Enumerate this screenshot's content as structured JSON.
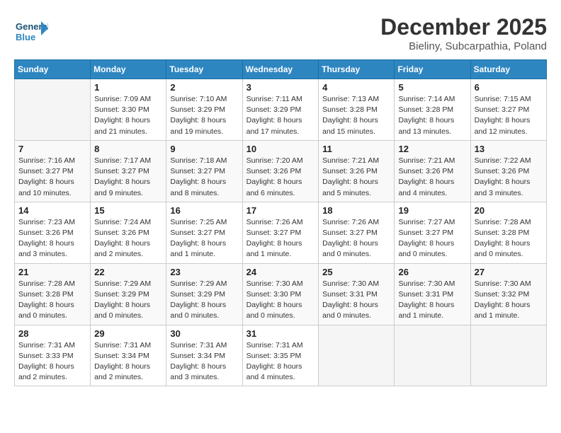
{
  "header": {
    "logo_general": "General",
    "logo_blue": "Blue",
    "month": "December 2025",
    "location": "Bieliny, Subcarpathia, Poland"
  },
  "weekdays": [
    "Sunday",
    "Monday",
    "Tuesday",
    "Wednesday",
    "Thursday",
    "Friday",
    "Saturday"
  ],
  "weeks": [
    [
      {
        "day": "",
        "info": ""
      },
      {
        "day": "1",
        "info": "Sunrise: 7:09 AM\nSunset: 3:30 PM\nDaylight: 8 hours\nand 21 minutes."
      },
      {
        "day": "2",
        "info": "Sunrise: 7:10 AM\nSunset: 3:29 PM\nDaylight: 8 hours\nand 19 minutes."
      },
      {
        "day": "3",
        "info": "Sunrise: 7:11 AM\nSunset: 3:29 PM\nDaylight: 8 hours\nand 17 minutes."
      },
      {
        "day": "4",
        "info": "Sunrise: 7:13 AM\nSunset: 3:28 PM\nDaylight: 8 hours\nand 15 minutes."
      },
      {
        "day": "5",
        "info": "Sunrise: 7:14 AM\nSunset: 3:28 PM\nDaylight: 8 hours\nand 13 minutes."
      },
      {
        "day": "6",
        "info": "Sunrise: 7:15 AM\nSunset: 3:27 PM\nDaylight: 8 hours\nand 12 minutes."
      }
    ],
    [
      {
        "day": "7",
        "info": "Sunrise: 7:16 AM\nSunset: 3:27 PM\nDaylight: 8 hours\nand 10 minutes."
      },
      {
        "day": "8",
        "info": "Sunrise: 7:17 AM\nSunset: 3:27 PM\nDaylight: 8 hours\nand 9 minutes."
      },
      {
        "day": "9",
        "info": "Sunrise: 7:18 AM\nSunset: 3:27 PM\nDaylight: 8 hours\nand 8 minutes."
      },
      {
        "day": "10",
        "info": "Sunrise: 7:20 AM\nSunset: 3:26 PM\nDaylight: 8 hours\nand 6 minutes."
      },
      {
        "day": "11",
        "info": "Sunrise: 7:21 AM\nSunset: 3:26 PM\nDaylight: 8 hours\nand 5 minutes."
      },
      {
        "day": "12",
        "info": "Sunrise: 7:21 AM\nSunset: 3:26 PM\nDaylight: 8 hours\nand 4 minutes."
      },
      {
        "day": "13",
        "info": "Sunrise: 7:22 AM\nSunset: 3:26 PM\nDaylight: 8 hours\nand 3 minutes."
      }
    ],
    [
      {
        "day": "14",
        "info": "Sunrise: 7:23 AM\nSunset: 3:26 PM\nDaylight: 8 hours\nand 3 minutes."
      },
      {
        "day": "15",
        "info": "Sunrise: 7:24 AM\nSunset: 3:26 PM\nDaylight: 8 hours\nand 2 minutes."
      },
      {
        "day": "16",
        "info": "Sunrise: 7:25 AM\nSunset: 3:27 PM\nDaylight: 8 hours\nand 1 minute."
      },
      {
        "day": "17",
        "info": "Sunrise: 7:26 AM\nSunset: 3:27 PM\nDaylight: 8 hours\nand 1 minute."
      },
      {
        "day": "18",
        "info": "Sunrise: 7:26 AM\nSunset: 3:27 PM\nDaylight: 8 hours\nand 0 minutes."
      },
      {
        "day": "19",
        "info": "Sunrise: 7:27 AM\nSunset: 3:27 PM\nDaylight: 8 hours\nand 0 minutes."
      },
      {
        "day": "20",
        "info": "Sunrise: 7:28 AM\nSunset: 3:28 PM\nDaylight: 8 hours\nand 0 minutes."
      }
    ],
    [
      {
        "day": "21",
        "info": "Sunrise: 7:28 AM\nSunset: 3:28 PM\nDaylight: 8 hours\nand 0 minutes."
      },
      {
        "day": "22",
        "info": "Sunrise: 7:29 AM\nSunset: 3:29 PM\nDaylight: 8 hours\nand 0 minutes."
      },
      {
        "day": "23",
        "info": "Sunrise: 7:29 AM\nSunset: 3:29 PM\nDaylight: 8 hours\nand 0 minutes."
      },
      {
        "day": "24",
        "info": "Sunrise: 7:30 AM\nSunset: 3:30 PM\nDaylight: 8 hours\nand 0 minutes."
      },
      {
        "day": "25",
        "info": "Sunrise: 7:30 AM\nSunset: 3:31 PM\nDaylight: 8 hours\nand 0 minutes."
      },
      {
        "day": "26",
        "info": "Sunrise: 7:30 AM\nSunset: 3:31 PM\nDaylight: 8 hours\nand 1 minute."
      },
      {
        "day": "27",
        "info": "Sunrise: 7:30 AM\nSunset: 3:32 PM\nDaylight: 8 hours\nand 1 minute."
      }
    ],
    [
      {
        "day": "28",
        "info": "Sunrise: 7:31 AM\nSunset: 3:33 PM\nDaylight: 8 hours\nand 2 minutes."
      },
      {
        "day": "29",
        "info": "Sunrise: 7:31 AM\nSunset: 3:34 PM\nDaylight: 8 hours\nand 2 minutes."
      },
      {
        "day": "30",
        "info": "Sunrise: 7:31 AM\nSunset: 3:34 PM\nDaylight: 8 hours\nand 3 minutes."
      },
      {
        "day": "31",
        "info": "Sunrise: 7:31 AM\nSunset: 3:35 PM\nDaylight: 8 hours\nand 4 minutes."
      },
      {
        "day": "",
        "info": ""
      },
      {
        "day": "",
        "info": ""
      },
      {
        "day": "",
        "info": ""
      }
    ]
  ]
}
